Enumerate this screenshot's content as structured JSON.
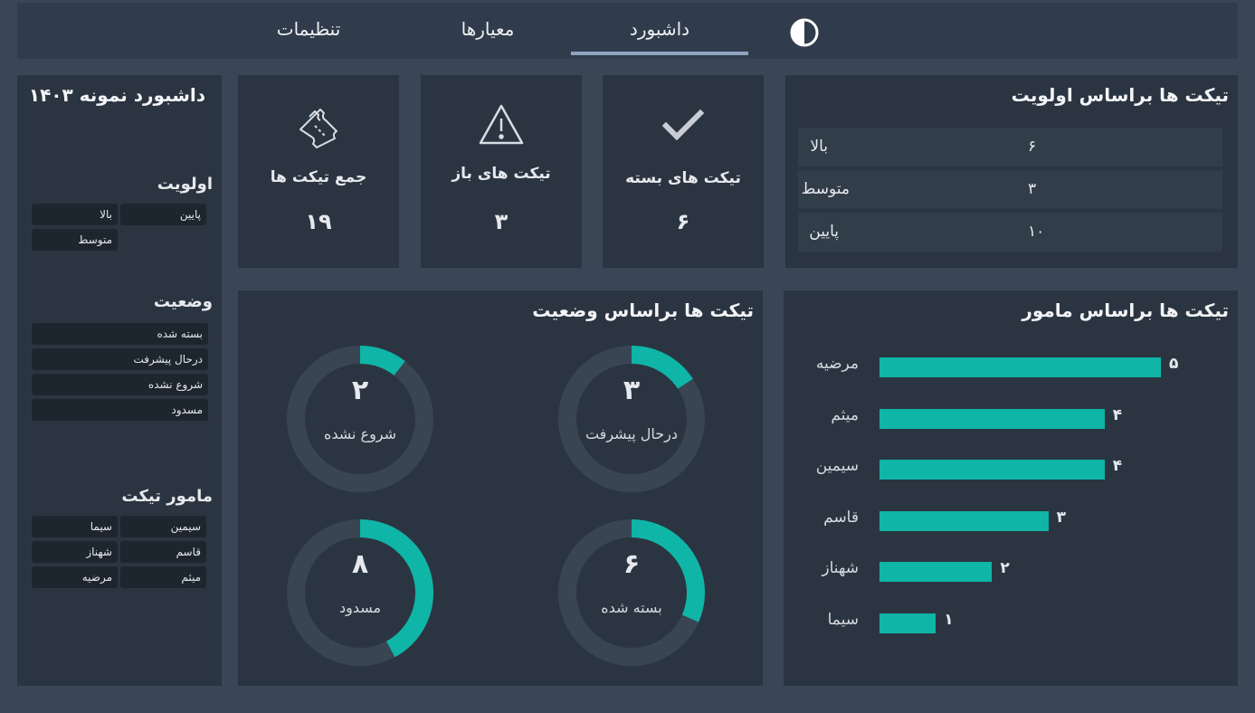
{
  "nav": {
    "tabs": [
      {
        "label": "تنظیمات",
        "active": false
      },
      {
        "label": "معیارها",
        "active": false
      },
      {
        "label": "داشبورد",
        "active": true
      }
    ],
    "theme_icon": "contrast-icon"
  },
  "filters": {
    "title": "داشبورد نمونه ۱۴۰۳",
    "priority": {
      "title": "اولویت",
      "options": [
        "پایین",
        "بالا",
        "متوسط"
      ]
    },
    "status": {
      "title": "وضعیت",
      "options": [
        "بسته شده",
        "درحال پیشرفت",
        "شروع نشده",
        "مسدود"
      ]
    },
    "agent": {
      "title": "مامور تیکت",
      "options": [
        "سیمین",
        "سیما",
        "قاسم",
        "شهناز",
        "میثم",
        "مرضیه"
      ]
    }
  },
  "kpis": [
    {
      "label": "جمع تیکت ها",
      "value": "۱۹",
      "icon": "ticket-icon"
    },
    {
      "label": "تیکت های باز",
      "value": "۳",
      "icon": "warning-icon"
    },
    {
      "label": "تیکت های بسته",
      "value": "۶",
      "icon": "check-icon"
    }
  ],
  "priority_table": {
    "title": "تیکت ها براساس اولویت",
    "rows": [
      {
        "name": "بالا",
        "value": "۶"
      },
      {
        "name": "متوسط",
        "value": "۳"
      },
      {
        "name": "پایین",
        "value": "۱۰"
      }
    ]
  },
  "status_chart": {
    "title": "تیکت ها براساس وضعیت",
    "total": 19,
    "items": [
      {
        "label": "شروع نشده",
        "value": 2,
        "display": "۲"
      },
      {
        "label": "درحال پیشرفت",
        "value": 3,
        "display": "۳"
      },
      {
        "label": "مسدود",
        "value": 8,
        "display": "۸"
      },
      {
        "label": "بسته شده",
        "value": 6,
        "display": "۶"
      }
    ]
  },
  "agent_chart": {
    "title": "تیکت ها براساس مامور",
    "items": [
      {
        "name": "مرضیه",
        "value": 5,
        "display": "۵"
      },
      {
        "name": "میثم",
        "value": 4,
        "display": "۴"
      },
      {
        "name": "سیمین",
        "value": 4,
        "display": "۴"
      },
      {
        "name": "قاسم",
        "value": 3,
        "display": "۳"
      },
      {
        "name": "شهناز",
        "value": 2,
        "display": "۲"
      },
      {
        "name": "سیما",
        "value": 1,
        "display": "۱"
      }
    ]
  },
  "colors": {
    "accent": "#0fb5a6",
    "ring_bg": "#3a4553",
    "panel": "#2b3541",
    "background": "#3a4655"
  }
}
